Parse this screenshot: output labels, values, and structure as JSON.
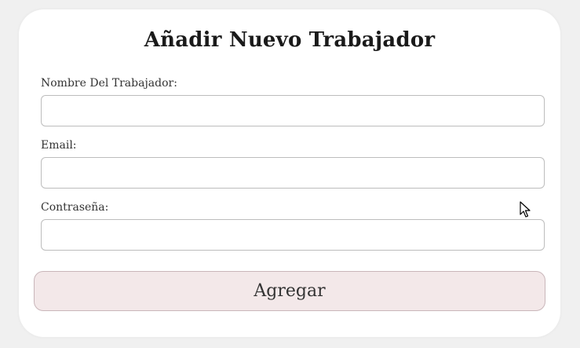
{
  "form": {
    "title": "Añadir Nuevo Trabajador",
    "fields": [
      {
        "label": "Nombre Del Trabajador:",
        "value": "",
        "placeholder": ""
      },
      {
        "label": "Email:",
        "value": "",
        "placeholder": ""
      },
      {
        "label": "Contraseña:",
        "value": "",
        "placeholder": ""
      }
    ],
    "submit_label": "Agregar"
  },
  "colors": {
    "page_background": "#f0f0f0",
    "card_background": "#ffffff",
    "button_background": "#f3e8e9",
    "button_border": "#c9b6ba"
  },
  "icons": {
    "cursor": "mouse-pointer-icon"
  }
}
